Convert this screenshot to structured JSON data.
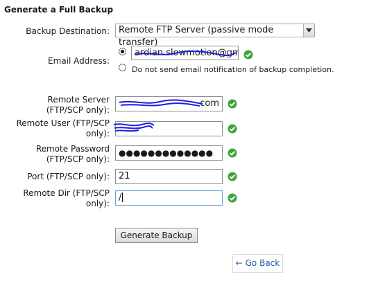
{
  "form": {
    "title": "Generate a Full Backup",
    "destination": {
      "label": "Backup Destination:",
      "value": "Remote FTP Server (passive mode transfer)"
    },
    "email": {
      "label": "Email Address:",
      "value": "ardian.slowmotion@gma",
      "no_email_label": "Do not send email notification of backup completion."
    },
    "remote_server": {
      "label_line1": "Remote Server",
      "label_line2": "(FTP/SCP only):",
      "value": "com"
    },
    "remote_user": {
      "label_line1": "Remote User (FTP/SCP",
      "label_line2": "only):",
      "value": ""
    },
    "remote_password": {
      "label_line1": "Remote Password",
      "label_line2": "(FTP/SCP only):",
      "value": "●●●●●●●●●●●●●"
    },
    "port": {
      "label": "Port (FTP/SCP only):",
      "value": "21"
    },
    "remote_dir": {
      "label_line1": "Remote Dir (FTP/SCP",
      "label_line2": "only):",
      "value": "/"
    },
    "generate_button": "Generate Backup",
    "go_back": "← Go Back"
  },
  "colors": {
    "valid_check": "#3aa63a",
    "scribble": "#1d1de0",
    "link": "#2255aa"
  },
  "icons": {
    "valid": "check-circle-icon",
    "select_arrow": "chevron-down-icon"
  }
}
